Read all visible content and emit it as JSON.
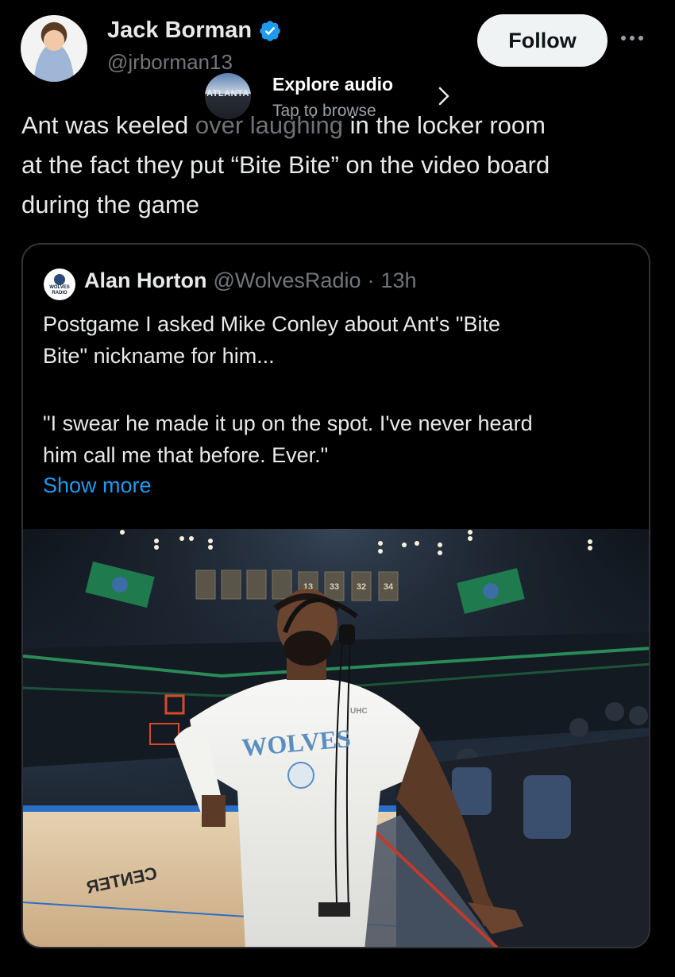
{
  "author": {
    "display_name": "Jack Borman",
    "handle": "@jrborman13",
    "follow_label": "Follow"
  },
  "audio": {
    "thumb_label": "ATLANTA",
    "title": "Explore audio",
    "subtitle": "Tap to browse"
  },
  "tweet": {
    "line1_a": "Ant was keeled",
    "line1_b": " over laughing",
    "line1_c": " in the locker room",
    "line2": "at the fact they put “Bite Bite” on the video board",
    "line3": "during the game"
  },
  "quote": {
    "avatar_text": "WOLVES RADIO",
    "name": "Alan Horton",
    "handle": "@WolvesRadio",
    "separator": "·",
    "time": "13h",
    "body_line1": "Postgame I asked Mike Conley about Ant's \"Bite",
    "body_line2": "Bite\" nickname for him...",
    "body_line3": "\"I swear he made it up on the spot. I've never heard",
    "body_line4": "him call me that before. Ever.\"",
    "show_more": "Show more"
  },
  "photo": {
    "banner_numbers": [
      "13",
      "33",
      "32",
      "34"
    ],
    "jersey_text": "WOLVES",
    "sponsor_text": "UHC",
    "court_text": "CENTER"
  },
  "colors": {
    "background": "#000000",
    "text": "#e7e9ea",
    "muted": "#71767b",
    "link": "#1d9bf0",
    "verified": "#1d9bf0",
    "wolves_green": "#236192"
  },
  "icons": {
    "verified": "verified-badge-icon",
    "more": "more-dots-icon",
    "chevron": "chevron-right-icon"
  }
}
